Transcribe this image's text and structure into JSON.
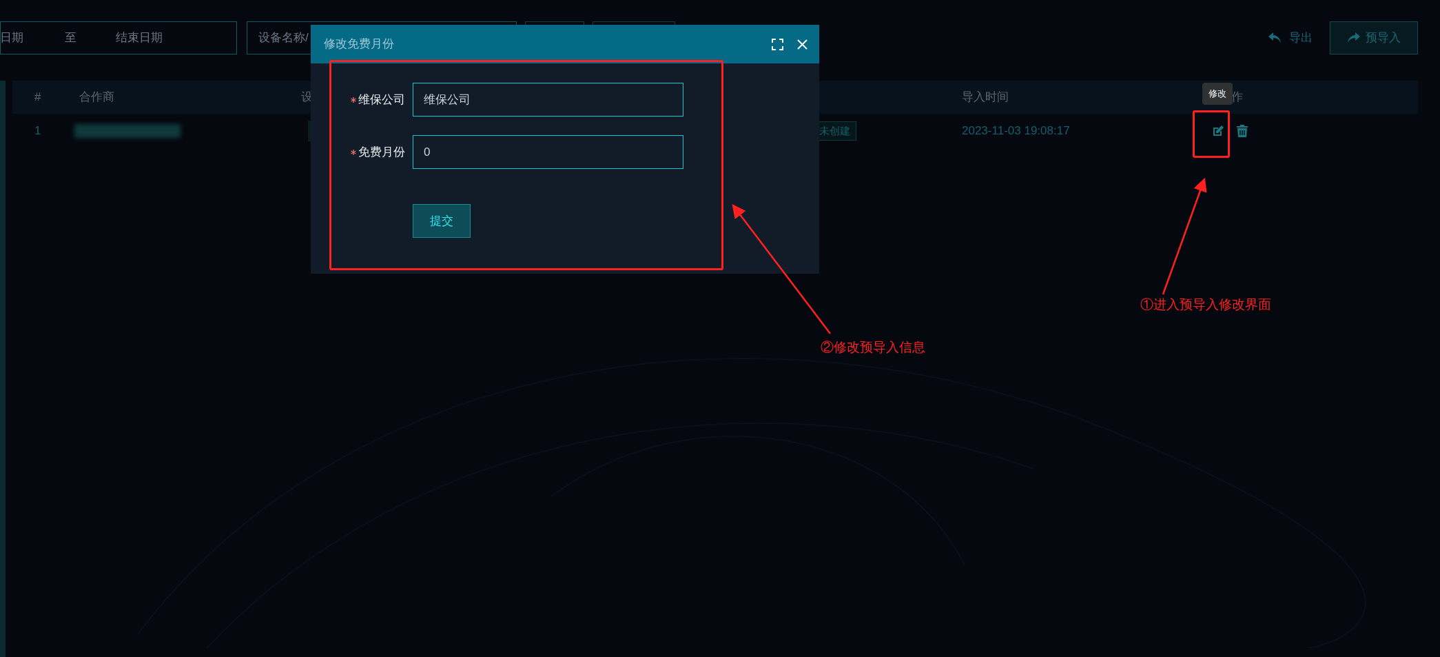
{
  "filters": {
    "start_date": "日期",
    "separator": "至",
    "end_date": "结束日期",
    "search_placeholder": "设备名称/"
  },
  "toolbar": {
    "export": "导出",
    "pre_import": "预导入"
  },
  "table": {
    "columns": [
      "#",
      "合作商",
      "设",
      "导入时间",
      "作"
    ],
    "rows": [
      {
        "index": "1",
        "status_tag": "未创建",
        "import_time": "2023-11-03 19:08:17"
      }
    ]
  },
  "tooltip": "修改",
  "dialog": {
    "title": "修改免费月份",
    "fields": [
      {
        "label": "维保公司",
        "required": true,
        "value": "维保公司"
      },
      {
        "label": "免费月份",
        "required": true,
        "value": "0"
      }
    ],
    "submit": "提交"
  },
  "annotations": [
    {
      "kind": "step1",
      "text": "①进入预导入修改界面"
    },
    {
      "kind": "step2",
      "text": "②修改预导入信息"
    }
  ]
}
